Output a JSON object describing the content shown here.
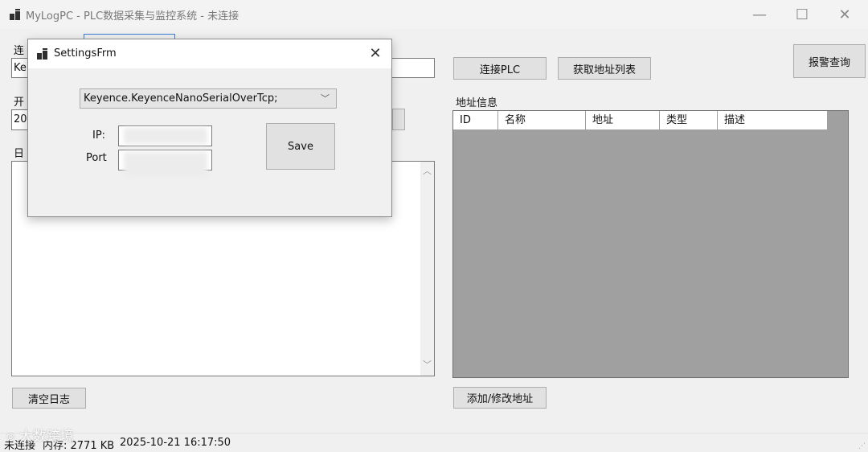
{
  "window": {
    "title": "MyLogPC - PLC数据采集与监控系统 - 未连接",
    "minimize": "—",
    "maximize": "☐",
    "close": "✕"
  },
  "left_panel": {
    "conn_label_partial": "连",
    "conn_value_partial": "Ke",
    "start_label_partial": "开",
    "start_value_partial": "20",
    "log_label_partial": "日",
    "clear_log_button": "清空日志"
  },
  "toolbar": {
    "connect_plc_button": "连接PLC",
    "get_address_list_button": "获取地址列表",
    "alarm_query_button": "报警查询"
  },
  "address_panel": {
    "label": "地址信息",
    "columns": [
      "ID",
      "名称",
      "地址",
      "类型",
      "描述"
    ],
    "add_modify_button": "添加/修改地址"
  },
  "statusbar": {
    "connection": "未连接",
    "memory": "内存: 2771 KB",
    "datetime": "2025-10-21 16:17:50",
    "watermark": "大数跨境"
  },
  "settings_dialog": {
    "title": "SettingsFrm",
    "close": "✕",
    "protocol_selected": "Keyence.KeyenceNanoSerialOverTcp;",
    "ip_label": "IP:",
    "port_label": "Port",
    "save_button": "Save"
  }
}
